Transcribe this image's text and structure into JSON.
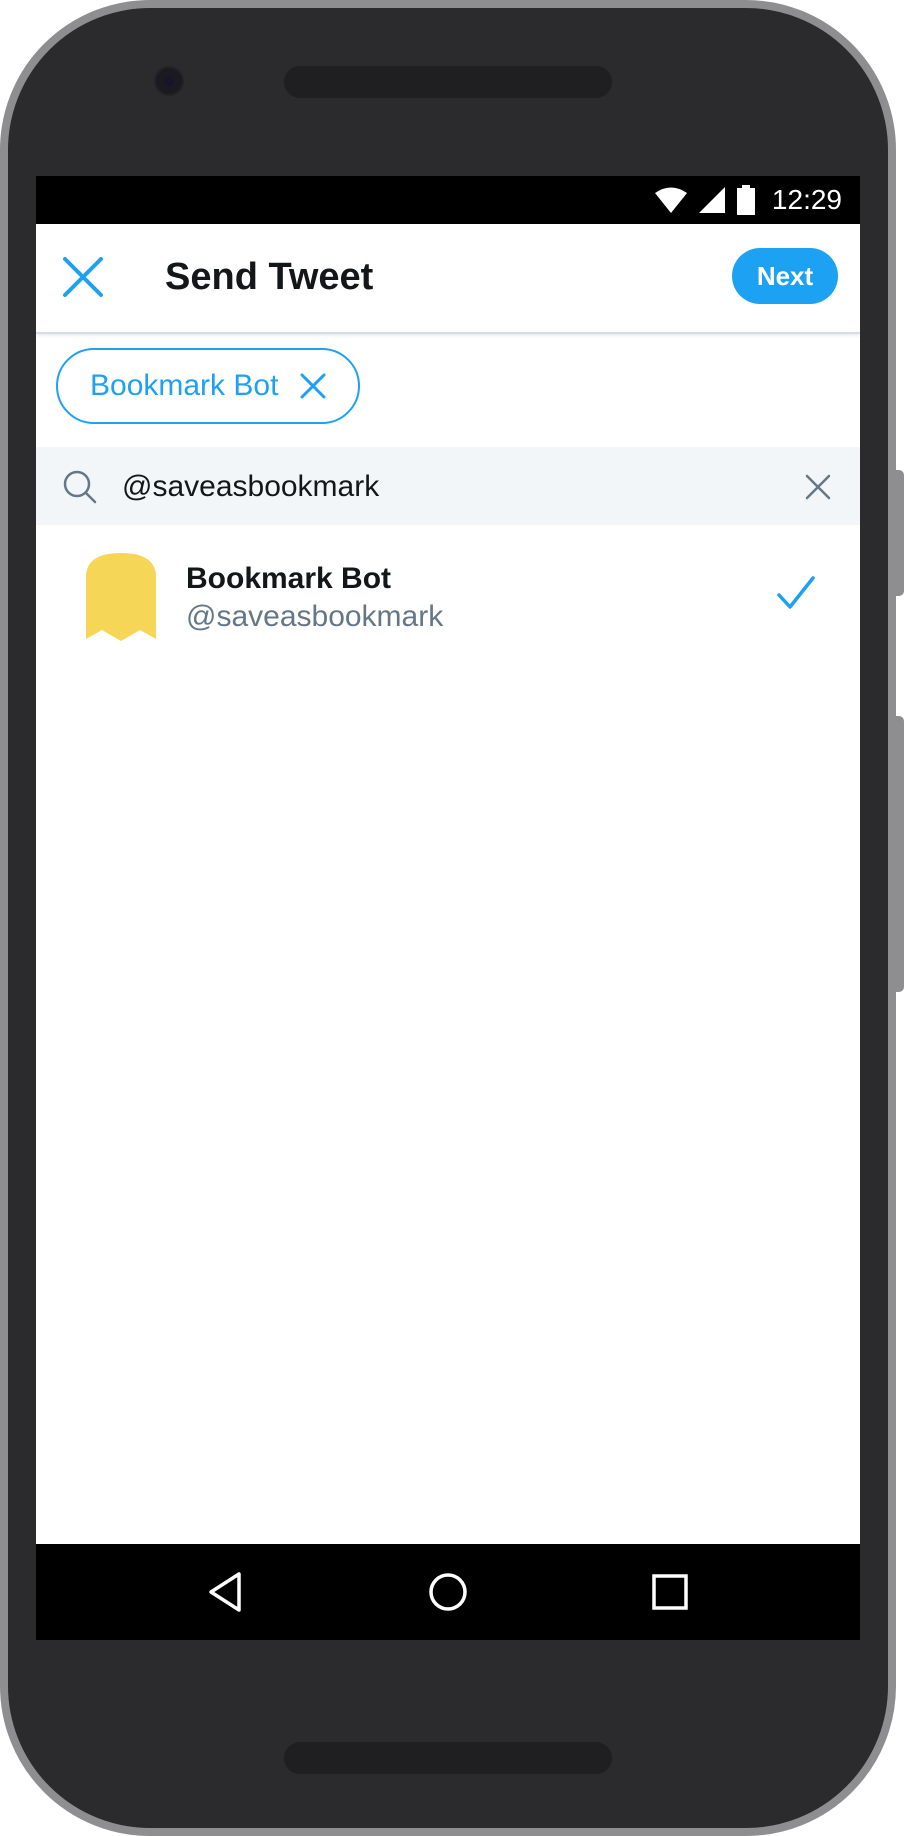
{
  "status_bar": {
    "time": "12:29",
    "icons": [
      "wifi-icon",
      "signal-icon",
      "battery-icon"
    ]
  },
  "app_bar": {
    "close_icon": "close-icon",
    "title": "Send Tweet",
    "next_label": "Next"
  },
  "selected_chip": {
    "label": "Bookmark Bot",
    "remove_icon": "close-icon"
  },
  "search": {
    "value": "@saveasbookmark",
    "icon": "search-icon",
    "clear_icon": "clear-icon"
  },
  "results": [
    {
      "name": "Bookmark Bot",
      "handle": "@saveasbookmark",
      "selected": true,
      "avatar_color": "#f5d656"
    }
  ],
  "nav_bar": {
    "buttons": [
      "back-icon",
      "home-icon",
      "recents-icon"
    ]
  },
  "colors": {
    "accent": "#1da1f2",
    "text_primary": "#14171a",
    "text_secondary": "#657786",
    "search_bg": "#f3f6f8",
    "device_body": "#2b2a2d",
    "device_rim": "#8e8d90"
  }
}
